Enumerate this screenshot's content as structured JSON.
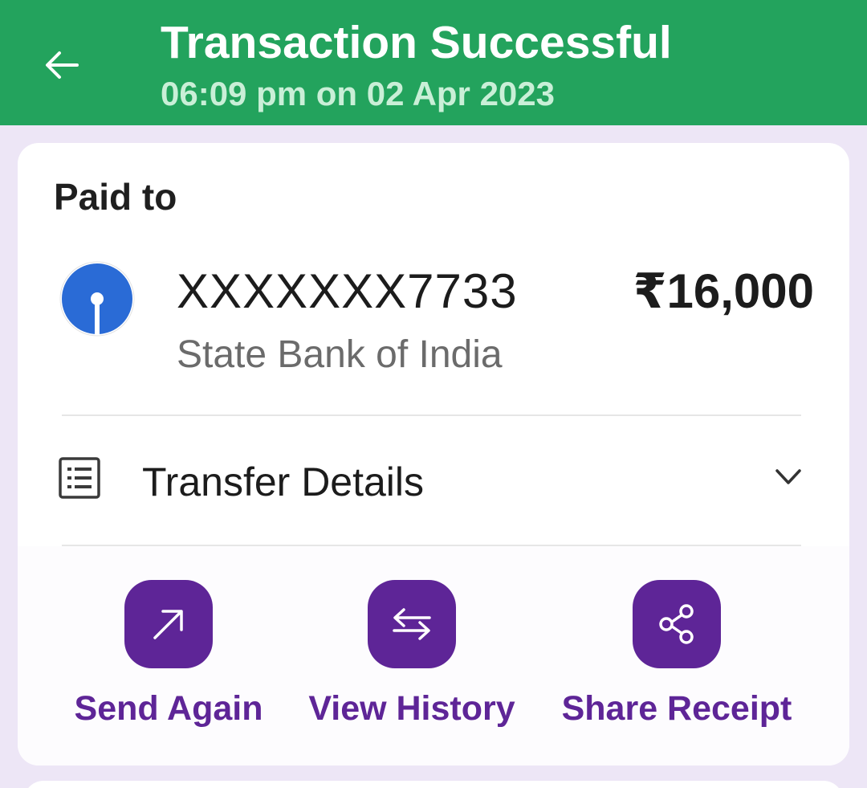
{
  "header": {
    "title": "Transaction Successful",
    "subtitle": "06:09 pm on 02 Apr 2023",
    "back_icon": "arrow-left-icon",
    "color": "#23a35d"
  },
  "payment": {
    "paid_to_label": "Paid to",
    "account_number": "XXXXXXX7733",
    "bank_name": "State Bank of India",
    "amount": "₹16,000",
    "bank_logo_icon": "sbi-logo-icon",
    "bank_logo_color": "#2a6bd6"
  },
  "transfer_details": {
    "label": "Transfer Details",
    "icon": "list-details-icon",
    "chevron_icon": "chevron-down-icon"
  },
  "actions": [
    {
      "label": "Send Again",
      "icon": "arrow-up-right-icon"
    },
    {
      "label": "View History",
      "icon": "swap-arrows-icon"
    },
    {
      "label": "Share Receipt",
      "icon": "share-icon"
    }
  ],
  "theme": {
    "accent": "#5e2597",
    "background": "#ede6f6"
  }
}
